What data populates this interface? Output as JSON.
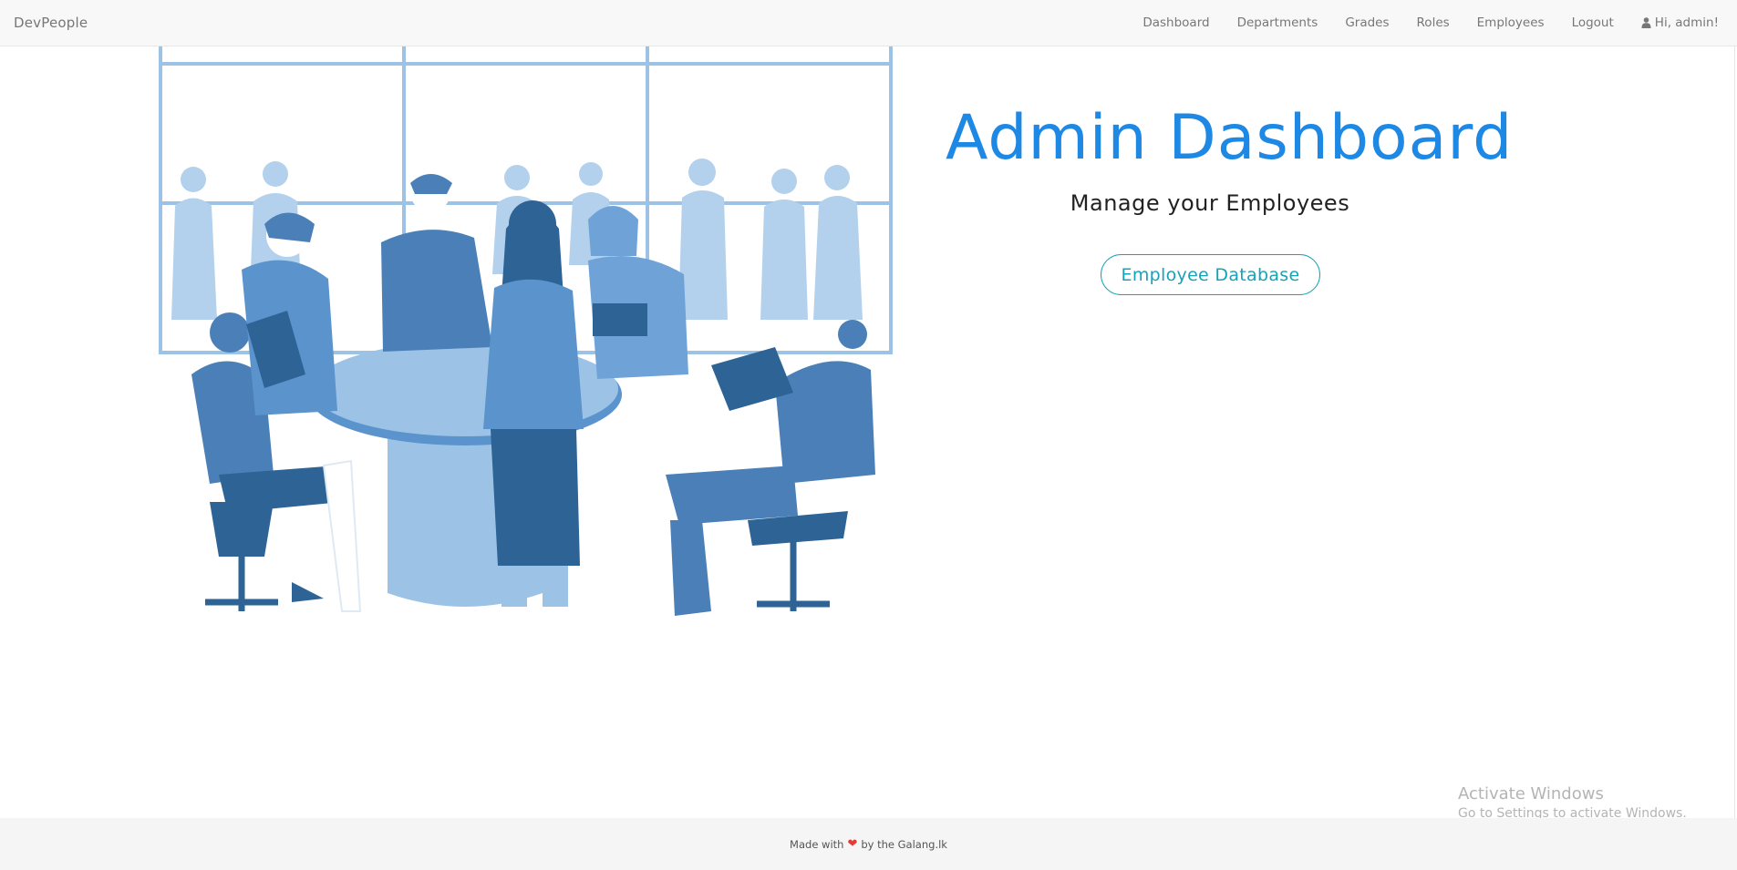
{
  "navbar": {
    "brand": "DevPeople",
    "links": [
      "Dashboard",
      "Departments",
      "Grades",
      "Roles",
      "Employees",
      "Logout"
    ],
    "user_greeting": "Hi, admin!",
    "user_icon": "user-icon"
  },
  "hero": {
    "title": "Admin Dashboard",
    "subtitle": "Manage your Employees",
    "button_label": "Employee Database"
  },
  "footer": {
    "text_before": "Made with",
    "heart_icon": "heart-icon",
    "text_after": "by the Galang.lk"
  },
  "watermark": {
    "title": "Activate Windows",
    "subtitle": "Go to Settings to activate Windows."
  },
  "colors": {
    "accent_blue": "#1e88e5",
    "button_teal": "#17a2b8",
    "illustration_dark": "#2e6396",
    "illustration_mid": "#4a7fb7",
    "illustration_light": "#b3d1ec"
  }
}
